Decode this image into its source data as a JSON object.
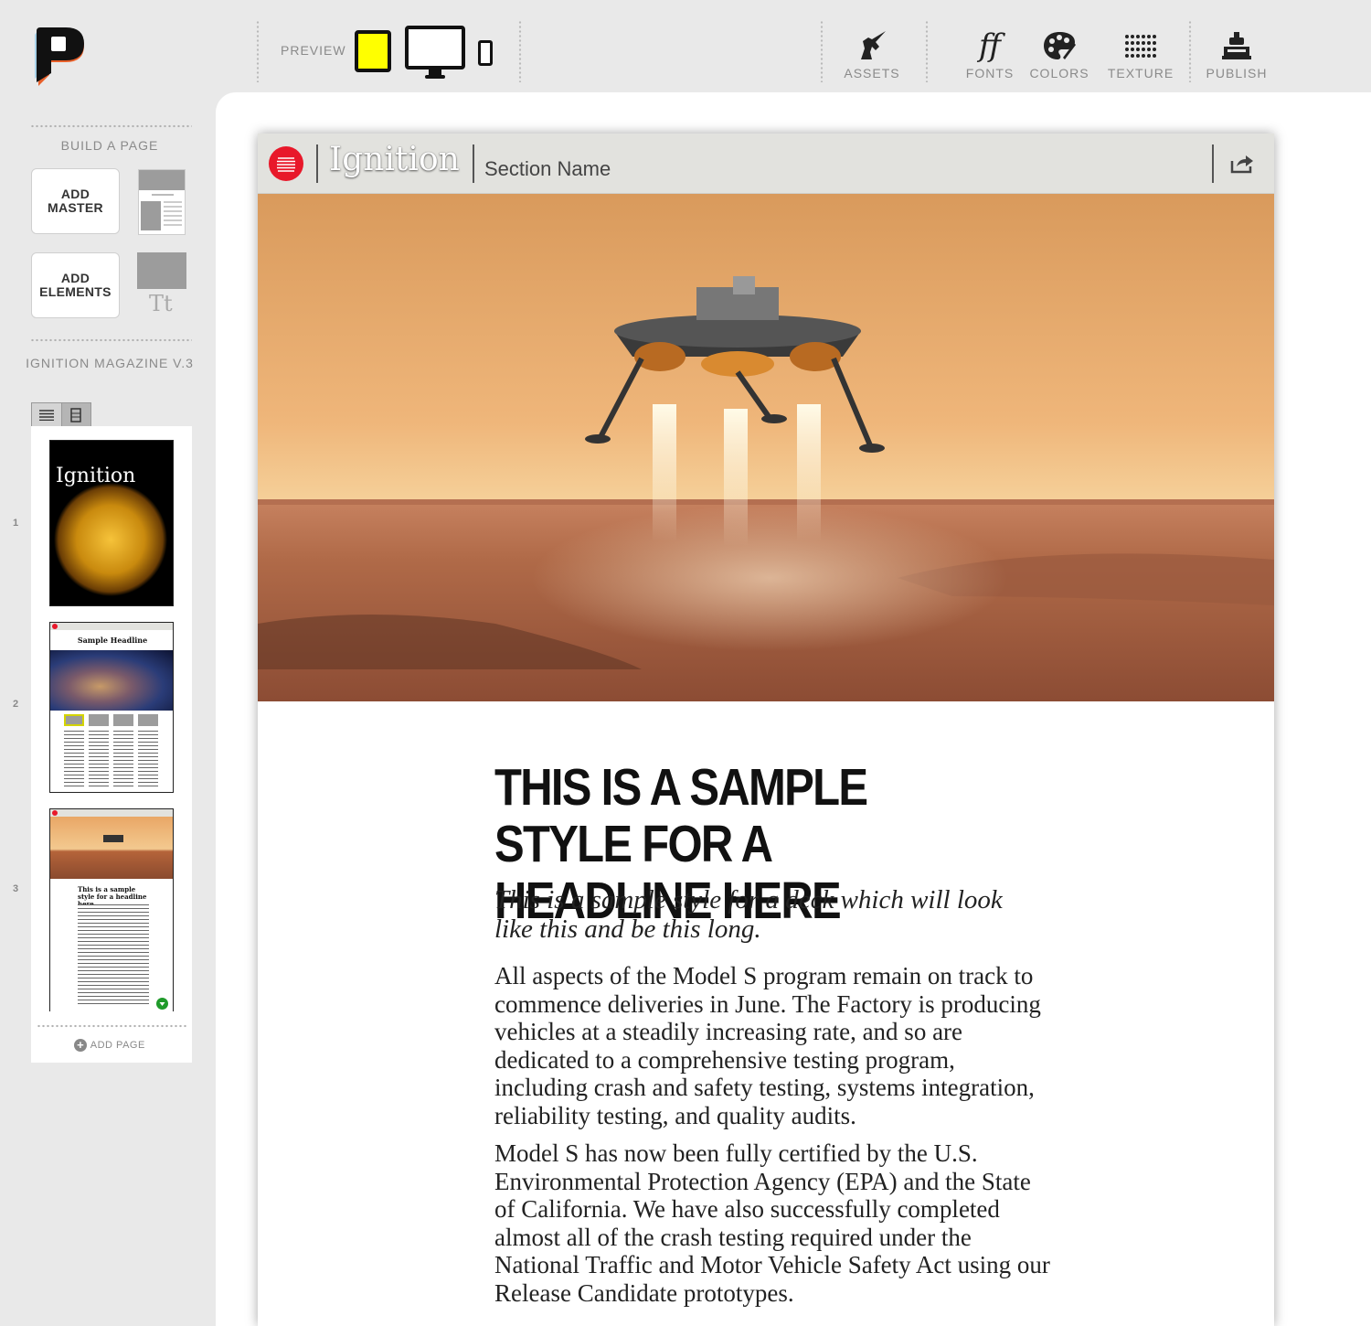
{
  "toolbar": {
    "preview_label": "PREVIEW",
    "assets_label": "ASSETS",
    "fonts_label": "FONTS",
    "colors_label": "COLORS",
    "texture_label": "TEXTURE",
    "publish_label": "PUBLISH",
    "fonts_glyph": "ff",
    "active_device": "tablet",
    "accent_color": "#ffff00"
  },
  "sidebar": {
    "build_title": "BUILD A PAGE",
    "add_master": "ADD MASTER",
    "add_elements": "ADD ELEMENTS",
    "elements_glyph": "Tt",
    "magazine_title": "IGNITION MAGAZINE V.3",
    "add_page": "ADD PAGE",
    "pages": [
      {
        "number": "1",
        "cover_title": "Ignition"
      },
      {
        "number": "2",
        "headline": "Sample Headline"
      },
      {
        "number": "3",
        "headline": "This is a sample style for a headline here"
      }
    ]
  },
  "article": {
    "brand": "Ignition",
    "section_name": "Section Name",
    "brand_color": "#e8182a",
    "headline": "THIS IS A SAMPLE STYLE FOR A HEADLINE HERE",
    "deck": "This is a sample style for a deck which will look like this and be this long.",
    "paragraphs": [
      "All aspects of the Model S program remain on track to commence deliveries in June. The Factory is producing vehicles at a steadily increasing rate, and so are dedicated to a comprehensive testing program, including crash and safety testing, systems integration, reliability testing, and quality audits.",
      "Model S has now been fully certified by the U.S. Environmental Protection Agency (EPA) and the State of California. We have also successfully completed almost all of the crash testing required under the National Traffic and Motor Vehicle Safety Act using our Release Candidate prototypes."
    ]
  }
}
